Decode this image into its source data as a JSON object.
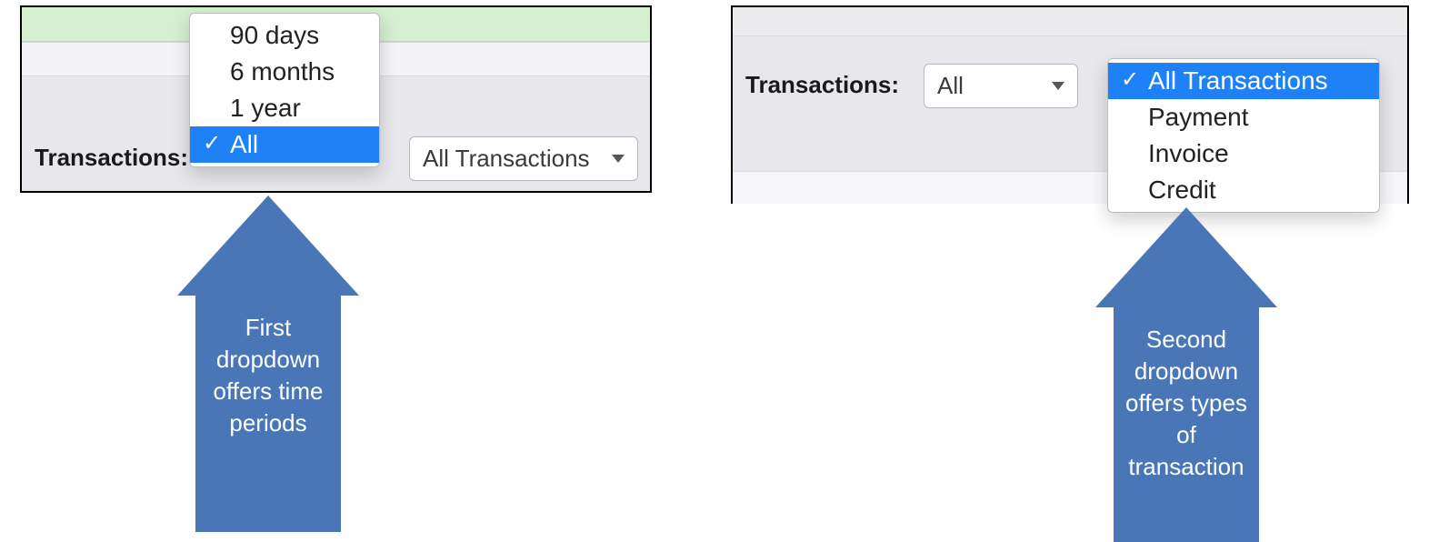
{
  "left": {
    "label": "Transactions:",
    "time_dropdown": {
      "options": [
        "90 days",
        "6 months",
        "1 year",
        "All"
      ],
      "selected": "All"
    },
    "type_select_closed": "All Transactions",
    "annotation": "First dropdown offers time periods"
  },
  "right": {
    "label": "Transactions:",
    "time_select_closed": "All",
    "type_dropdown": {
      "options": [
        "All Transactions",
        "Payment",
        "Invoice",
        "Credit"
      ],
      "selected": "All Transactions"
    },
    "annotation": "Second dropdown offers types of transaction"
  }
}
